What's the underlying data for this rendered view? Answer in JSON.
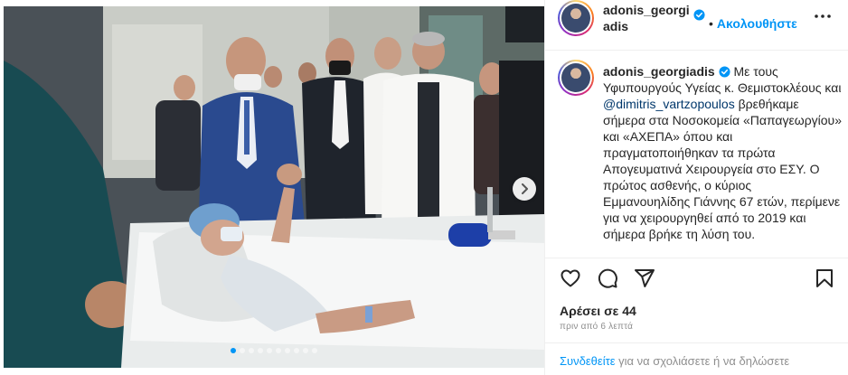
{
  "header": {
    "username": "adonis_georgiadis",
    "verified": true,
    "separator": "•",
    "follow_label": "Ακολουθήστε",
    "icons": {
      "avatar": "profile-avatar",
      "verified": "verified-badge-icon",
      "more": "more-options-icon"
    }
  },
  "media": {
    "next_icon": "chevron-right-icon",
    "slide_count": 10,
    "active_slide": 1,
    "description_hidden": "hospital room photo"
  },
  "caption": {
    "username": "adonis_georgiadis",
    "text_1": " Με τους Υφυπουργούς Υγείας κ. Θεμιστοκλέους και ",
    "mention": "@dimitris_vartzopoulos",
    "text_2": " βρεθήκαμε σήμερα στα Νοσοκομεία «Παπαγεωργίου» και «ΑΧΕΠΑ» όπου και πραγματοποιήθηκαν τα πρώτα Απογευματινά Χειρουργεία στο ΕΣΥ. Ο πρώτος ασθενής, ο κύριος Εμμανουηλίδης Γιάννης 67 ετών, περίμενε για να χειρουργηθεί από το 2019 και σήμερα βρήκε τη λύση του."
  },
  "actions": {
    "like_icon": "heart-icon",
    "comment_icon": "comment-icon",
    "share_icon": "share-icon",
    "save_icon": "bookmark-icon"
  },
  "likes_text": "Αρέσει σε 44",
  "timestamp": "πριν από 6 λεπτά",
  "login_prompt": {
    "link": "Συνδεθείτε",
    "text": " για να σχολιάσετε ή να δηλώσετε"
  },
  "colors": {
    "accent": "#0095f6",
    "text": "#262626",
    "muted": "#8e8e8e",
    "border": "#efefef"
  }
}
